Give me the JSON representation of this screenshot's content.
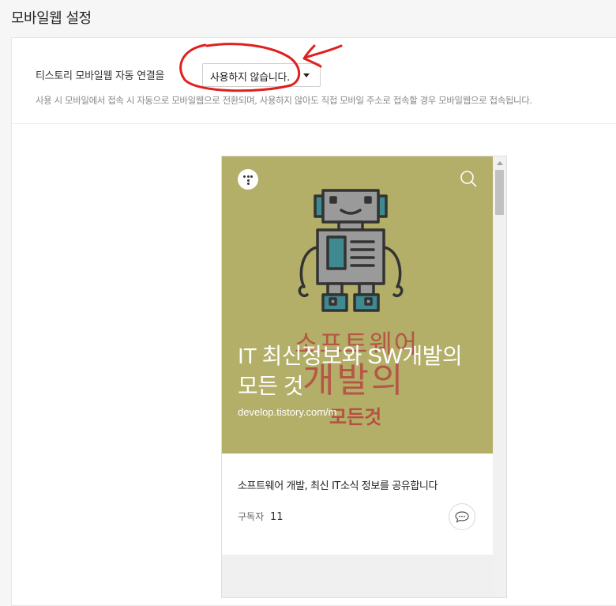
{
  "page": {
    "title": "모바일웹 설정"
  },
  "setting": {
    "label": "티스토리 모바일웹 자동 연결을",
    "selected": "사용하지 않습니다.",
    "description": "사용 시 모바일에서 접속 시 자동으로 모바일웹으로 전환되며, 사용하지 않아도 직접 모바일 주소로 접속할 경우 모바일웹으로 접속됩니다."
  },
  "preview": {
    "hero_bg": "#b3ae68",
    "title": "IT 최신정보와 SW개발의 모든 것",
    "url": "develop.tistory.com/m",
    "watermark_lines": [
      "소프트웨어",
      "개발의",
      "모든것"
    ],
    "description": "소프트웨어 개발, 최신 IT소식 정보를 공유합니다",
    "subscriber_label": "구독자",
    "subscriber_count": "11"
  },
  "icons": {
    "logo": "tistory-logo-icon",
    "search": "search-icon",
    "comment": "comment-icon"
  },
  "colors": {
    "annotation": "#e0201c"
  }
}
